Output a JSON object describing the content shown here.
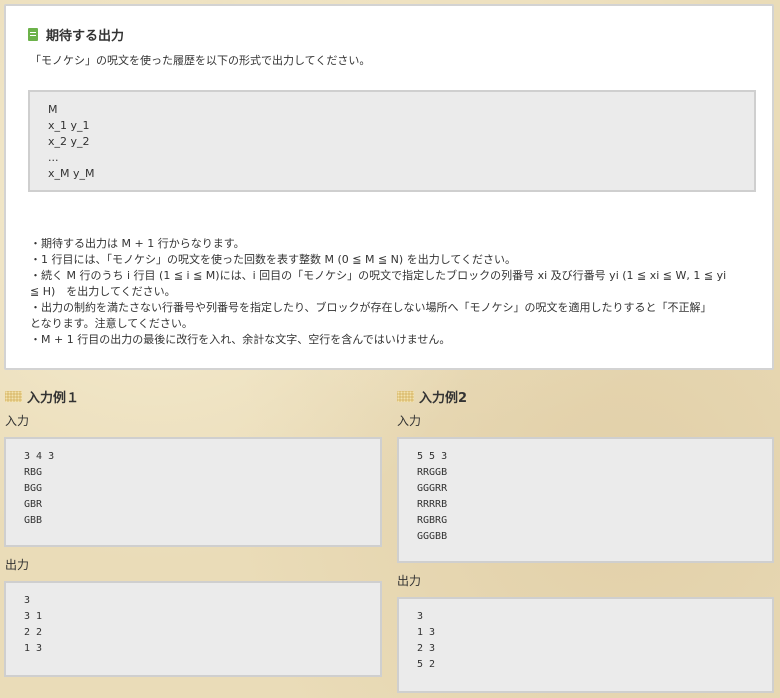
{
  "expected": {
    "title": "期待する出力",
    "intro": "「モノケシ」の呪文を使った履歴を以下の形式で出力してください。",
    "format_lines": [
      "M",
      "x_1 y_1",
      "x_2 y_2",
      "...",
      "x_M y_M"
    ],
    "notes": [
      "・期待する出力は M + 1 行からなります。",
      "・1 行目には、「モノケシ」の呪文を使った回数を表す整数 M (0 ≦ M ≦ N) を出力してください。",
      "・続く M 行のうち i 行目 (1 ≦ i ≦ M)には、i 回目の「モノケシ」の呪文で指定したブロックの列番号 xi 及び行番号 yi (1 ≦ xi ≦ W, 1 ≦ yi",
      "≦ H)　を出力してください。",
      "・出力の制約を満たさない行番号や列番号を指定したり、ブロックが存在しない場所へ「モノケシ」の呪文を適用したりすると「不正解」",
      "となります。注意してください。",
      "・M + 1 行目の出力の最後に改行を入れ、余計な文字、空行を含んではいけません。"
    ]
  },
  "examples": [
    {
      "title": "入力例１",
      "input_label": "入力",
      "input_lines": [
        "3 4 3",
        "RBG",
        "BGG",
        "GBR",
        "GBB"
      ],
      "output_label": "出力",
      "output_lines": [
        "3",
        "3 1",
        "2 2",
        "1 3"
      ]
    },
    {
      "title": "入力例2",
      "input_label": "入力",
      "input_lines": [
        "5 5 3",
        "RRGGB",
        "GGGRR",
        "RRRRB",
        "RGBRG",
        "GGGBB"
      ],
      "output_label": "出力",
      "output_lines": [
        "3",
        "1 3",
        "2 3",
        "5 2"
      ]
    }
  ]
}
